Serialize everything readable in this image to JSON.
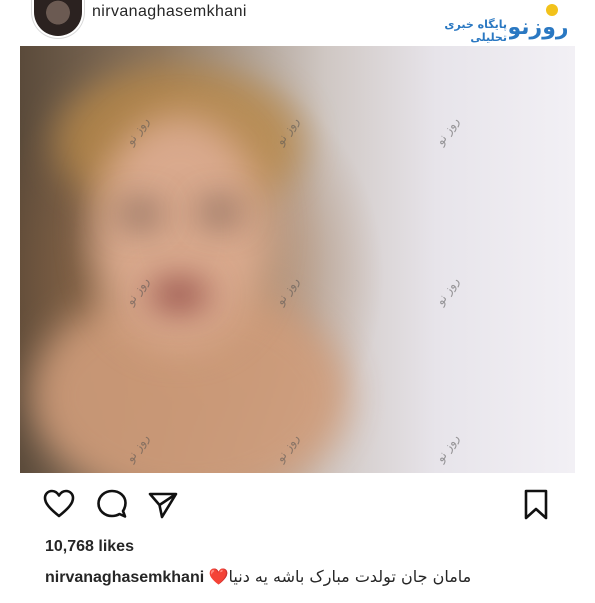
{
  "post": {
    "username": "nirvanaghasemkhani",
    "likes_text": "10,768 likes",
    "caption_user": "nirvanaghasemkhani",
    "caption_emoji": "❤️",
    "caption_text": "مامان جان تولدت مبارک باشه یه دنیا"
  },
  "brand": {
    "tagline": "پایگاه خبری تحلیلی",
    "logo_text": "روزنو"
  },
  "photo": {
    "watermark": "روز نو"
  },
  "icons": [
    "like-heart-icon",
    "comment-icon",
    "share-icon",
    "save-bookmark-icon"
  ],
  "colors": {
    "brand_blue": "#2a78c2",
    "brand_yellow": "#f2c21b",
    "lips": "#6e1a22",
    "heart_red": "#e0202e"
  }
}
